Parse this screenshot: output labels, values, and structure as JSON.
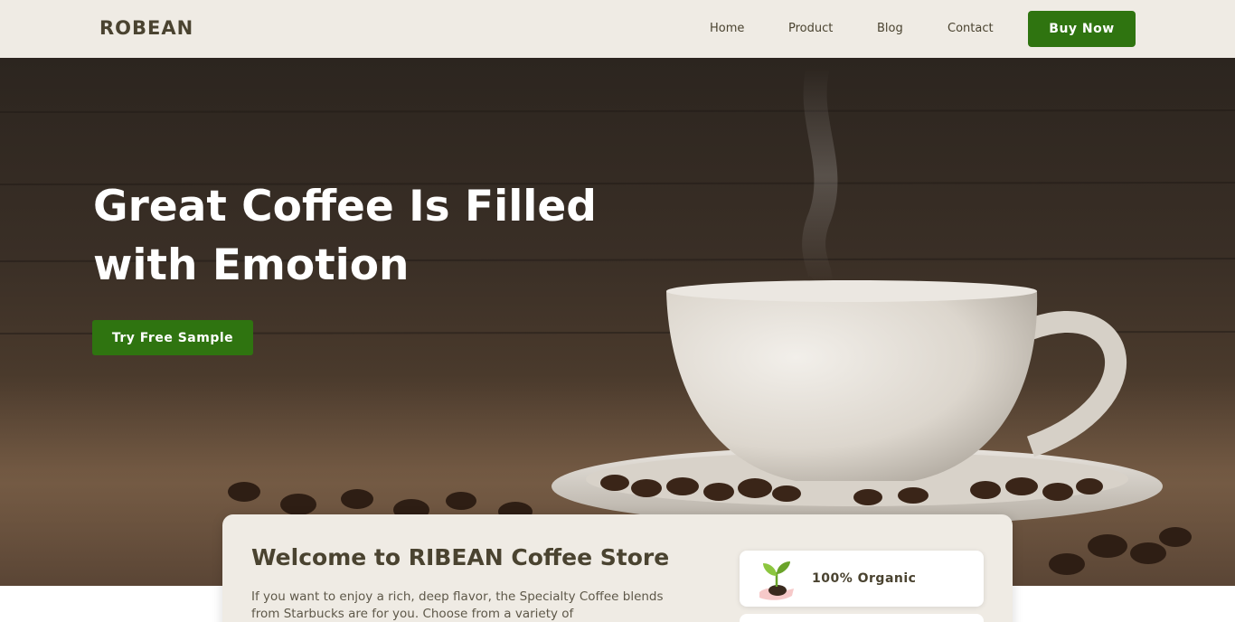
{
  "brand": {
    "logo": "ROBEAN"
  },
  "nav": {
    "items": [
      "Home",
      "Product",
      "Blog",
      "Contact"
    ],
    "cta": "Buy Now"
  },
  "hero": {
    "title_line1": "Great Coffee Is Filled",
    "title_line2": "with Emotion",
    "cta": "Try Free Sample"
  },
  "welcome": {
    "title": "Welcome to RIBEAN Coffee Store",
    "text": "If you want to enjoy a rich, deep flavor, the Specialty Coffee blends from Starbucks are for you. Choose from a variety of"
  },
  "features": [
    {
      "label": "100% Organic",
      "icon": "sprout-in-hand-icon"
    }
  ],
  "colors": {
    "accent": "#2f7410",
    "nav_bg": "#efebe4",
    "text_dark": "#4a4330"
  }
}
